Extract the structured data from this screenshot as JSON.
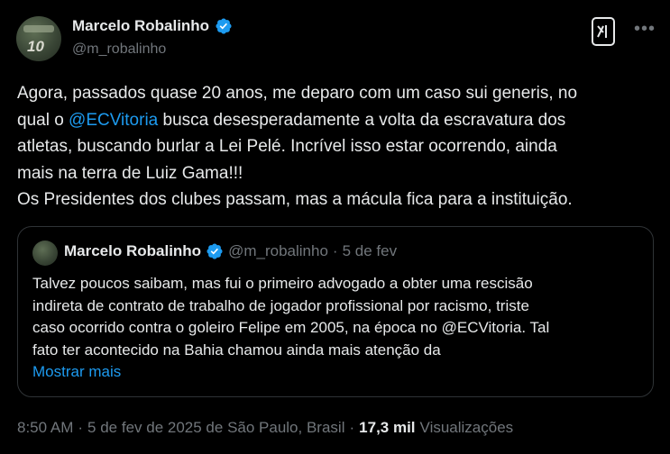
{
  "author": {
    "name": "Marcelo Robalinho",
    "handle": "@m_robalinho",
    "avatar_number": "10"
  },
  "tweet": {
    "line1": "Agora, passados quase 20 anos, me deparo com um caso sui generis, no",
    "line2_pre": "qual o ",
    "mention": "@ECVitoria",
    "line2_post": " busca desesperadamente a volta da escravatura dos",
    "line3": "atletas, buscando burlar a Lei Pelé. Incrível isso estar ocorrendo, ainda",
    "line4": "mais na terra de Luiz Gama!!!",
    "line5": "Os Presidentes dos clubes passam, mas a mácula fica para a instituição."
  },
  "quote": {
    "name": "Marcelo Robalinho",
    "handle": "@m_robalinho",
    "dot": "·",
    "date": "5 de fev",
    "lines": [
      "Talvez poucos saibam, mas fui o primeiro advogado a obter uma rescisão",
      "indireta de contrato de trabalho de jogador profissional por racismo, triste",
      "caso ocorrido contra o goleiro Felipe em 2005, na época no @ECVitoria. Tal",
      "fato ter acontecido na Bahia chamou ainda mais atenção da"
    ],
    "show_more": "Mostrar mais"
  },
  "meta": {
    "time": "8:50 AM",
    "sep1": "·",
    "date_location": "5 de fev de 2025 de São Paulo, Brasil",
    "sep2": "·",
    "views_count": "17,3 mil",
    "views_label": "Visualizações"
  },
  "colors": {
    "background": "#000000",
    "text": "#e7e9ea",
    "muted": "#71767b",
    "link": "#1d9bf0",
    "border": "#2f3336"
  },
  "icons": {
    "verified": "verified-badge-icon",
    "grok": "grok-icon",
    "more": "more-options-icon"
  }
}
